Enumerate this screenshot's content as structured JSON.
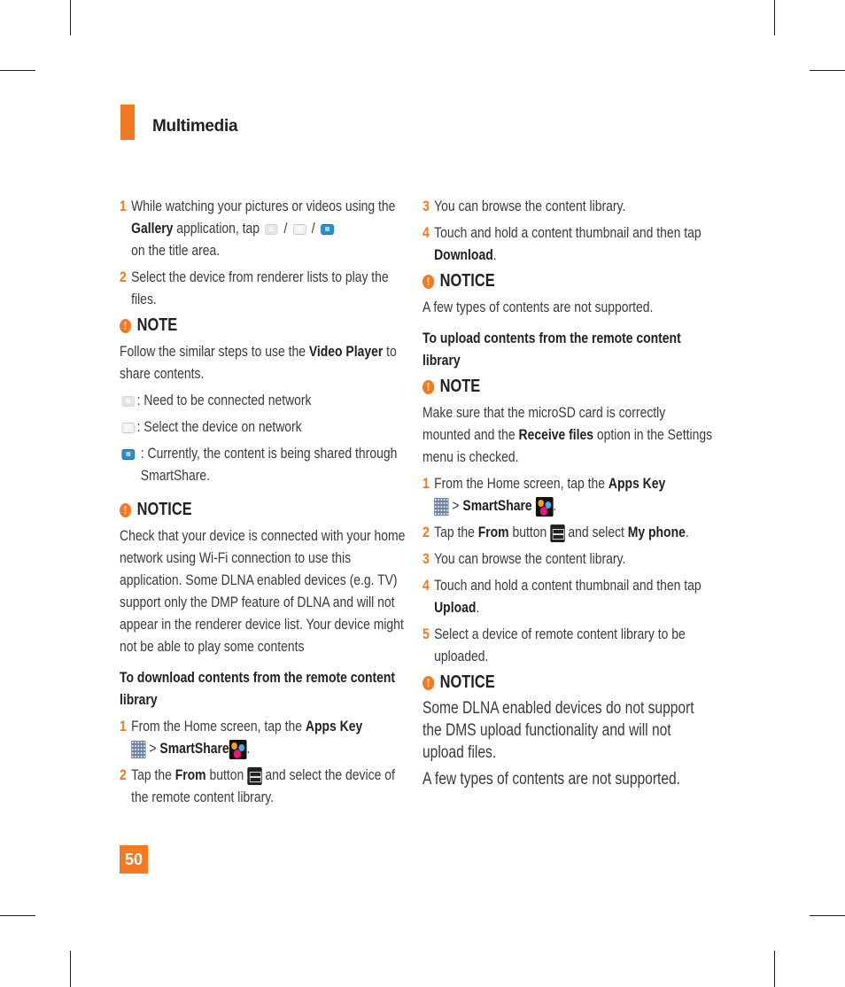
{
  "header": {
    "section_title": "Multimedia"
  },
  "page_number": "50",
  "colors": {
    "accent": "#f47920",
    "text": "#3a3a3a",
    "heading": "#231f20"
  },
  "left": {
    "steps": [
      {
        "num": "1",
        "t1": "While watching your pictures or videos using the ",
        "b1": "Gallery",
        "t2": " application, tap ",
        "sep1": " / ",
        "sep2": " / ",
        "t3": " on the title area."
      },
      {
        "num": "2",
        "text": "Select the device from renderer lists to play the files."
      }
    ],
    "note": {
      "title": "NOTE",
      "t1": "Follow the similar steps to use the ",
      "b1": "Video Player",
      "t2": " to share contents.",
      "icons": [
        {
          "icon": "network-off-icon",
          "text": ": Need to be connected network"
        },
        {
          "icon": "network-select-icon",
          "text": ": Select the device on network"
        },
        {
          "icon": "network-sharing-icon",
          "text": ": Currently, the content is being shared through SmartShare."
        }
      ]
    },
    "notice": {
      "title": "NOTICE",
      "text": "Check that your device is connected with your home network using Wi-Fi connection to use this application. Some DLNA enabled devices (e.g. TV) support only the DMP feature of DLNA and will not appear in the renderer device list. Your device might not be able to play some contents"
    },
    "download": {
      "heading": "To download contents from the remote content library",
      "steps": [
        {
          "num": "1",
          "t1": "From the Home screen, tap the ",
          "b1": "Apps Key",
          "t2": " > ",
          "b2": "SmartShare",
          "t3": "."
        },
        {
          "num": "2",
          "t1": "Tap the ",
          "b1": "From",
          "t2": " button ",
          "t3": " and select the device of the remote content library."
        }
      ]
    }
  },
  "right": {
    "download_steps": [
      {
        "num": "3",
        "text": "You can browse the content library."
      },
      {
        "num": "4",
        "t1": "Touch and hold a content thumbnail and then tap ",
        "b1": "Download",
        "t2": "."
      }
    ],
    "notice1": {
      "title": "NOTICE",
      "text": "A few types of contents are not supported."
    },
    "upload": {
      "heading": "To upload contents from the remote content library",
      "note": {
        "title": "NOTE",
        "t1": "Make sure that the microSD card is correctly mounted and the ",
        "b1": "Receive files",
        "t2": " option in the Settings menu is checked."
      },
      "steps": [
        {
          "num": "1",
          "t1": "From the Home screen, tap the ",
          "b1": "Apps Key",
          "t2": " > ",
          "b2": "SmartShare",
          "t3": "."
        },
        {
          "num": "2",
          "t1": "Tap the ",
          "b1": "From",
          "t2": " button ",
          "t3": " and select ",
          "b2": "My phone",
          "t4": "."
        },
        {
          "num": "3",
          "text": "You can browse the content library."
        },
        {
          "num": "4",
          "t1": "Touch and hold a content thumbnail and then tap ",
          "b1": "Upload",
          "t2": "."
        },
        {
          "num": "5",
          "text": "Select a device of remote content library to be uploaded."
        }
      ]
    },
    "notice2": {
      "title": "NOTICE",
      "text1": "Some DLNA enabled devices do not support the DMS upload functionality and will not upload files.",
      "text2": "A few types of contents are not supported."
    }
  }
}
